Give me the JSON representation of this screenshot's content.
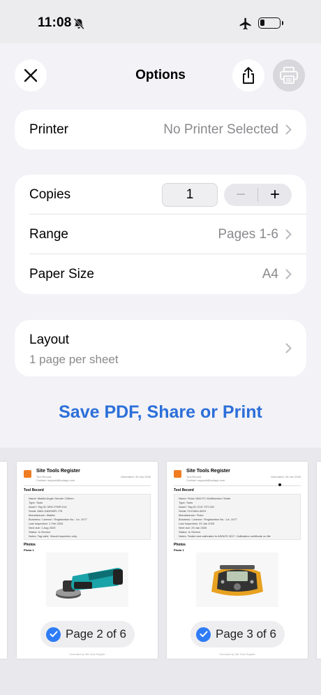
{
  "status_bar": {
    "time": "11:08",
    "battery_level": 0.25
  },
  "header": {
    "title": "Options"
  },
  "printer": {
    "label": "Printer",
    "value": "No Printer Selected"
  },
  "settings": {
    "copies_label": "Copies",
    "copies_value": "1",
    "stepper_minus": "−",
    "stepper_plus": "+",
    "range_label": "Range",
    "range_value": "Pages 1-6",
    "paper_label": "Paper Size",
    "paper_value": "A4"
  },
  "layout": {
    "label": "Layout",
    "value": "1 page per sheet"
  },
  "action": {
    "label": "Save PDF, Share or Print"
  },
  "previews": [
    {
      "brand": "Site Tools Register",
      "brand_sub": "Tool Record",
      "contact": "Contact: support@toolapp.com",
      "generated": "Generated: 26 Jan 2026",
      "section": "Tool Record",
      "lines": [
        "Name: Makita Angle Grinder 125mm",
        "Type: Tools",
        "Asset / Tag ID: MSC-PWR-014",
        "Serial: MAK-GA5030R-778",
        "Manufacturer: Makita",
        "Business / Licence / Registration No.: Lic. 1077",
        "Last Inspection: 1 Feb 2025",
        "Next due: 1 Aug 2025",
        "Status: In Service",
        "Notes: Tag valid. Visual inspection only."
      ],
      "photos": "Photos",
      "photo1": "Photo 1",
      "footer": "Generated by Site Tools Register",
      "badge": "Page 2 of 6"
    },
    {
      "brand": "Site Tools Register",
      "brand_sub": "Tool Record",
      "contact": "Contact: support@toolapp.com",
      "generated": "Generated: 26 Jan 2026",
      "section": "Tool Record",
      "lines": [
        "Name: Fluke 1664 FC Multifunction Tester",
        "Type: Tools",
        "Asset / Tag ID: ELE-TST-031",
        "Serial: FLK1664-482X",
        "Manufacturer: Fluke",
        "Business / Licence / Registration No.: Lic. 1077",
        "Last Inspection: 29 Jan 2025",
        "Next due: 29 Jan 2026",
        "Status: In Service",
        "Notes: Tested and calibrated to AS/NZS 3017. Calibration certificate on file"
      ],
      "photos": "Photos",
      "photo1": "Photo 1",
      "footer": "Generated by Site Tools Register",
      "badge": "Page 3 of 6"
    }
  ]
}
